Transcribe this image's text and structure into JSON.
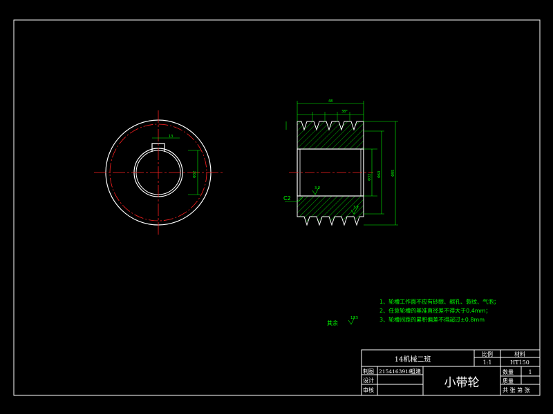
{
  "title_block": {
    "class_name": "14机械二班",
    "scale_label": "比例",
    "scale_value": "1:1",
    "material_label": "材料",
    "material_value": "HT150",
    "drawn_label": "制图",
    "drawn_value": "2154163918",
    "drawn_name": "祖建",
    "design_label": "设计",
    "review_label": "审核",
    "part_name": "小带轮",
    "quantity_label": "数量",
    "quantity_value": "1",
    "mass_label": "质量",
    "sheet_info": "共 张 第 张"
  },
  "notes": [
    "1、轮槽工作面不应有砂眼、缩孔、裂纹、气泡；",
    "2、任意轮槽的基准直径差不得大于0.4mm；",
    "3、轮槽间距的累积偏差不得超过±0.8mm"
  ],
  "roughness_other": "其余",
  "roughness_other_value": "12.5",
  "dimensions": {
    "overall_width": "48",
    "chamfer": "C2",
    "keyway": "13",
    "bore": "Φ32",
    "hub": "Φ60",
    "outer": "Φ95",
    "groove_angle": "38°",
    "roughness_1": "3.2",
    "roughness_2": "3.2"
  },
  "colors": {
    "background": "#000000",
    "frame": "#ffffff",
    "geometry": "#00ff00",
    "center_line": "#ff2020",
    "dimension": "#00ff00"
  }
}
